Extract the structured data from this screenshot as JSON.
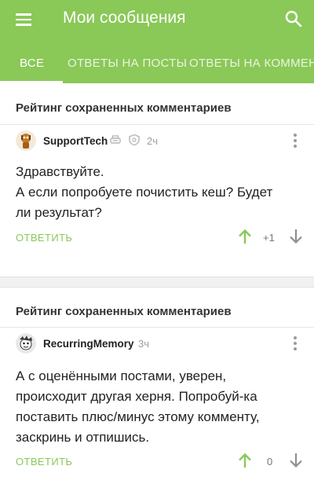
{
  "header": {
    "title": "Мои сообщения",
    "accent_color": "#8ac858",
    "menu_icon": "menu-icon",
    "search_icon": "search-icon"
  },
  "tabs": [
    {
      "label": "ВСЕ",
      "active": true
    },
    {
      "label": "ОТВЕТЫ НА ПОСТЫ",
      "active": false
    },
    {
      "label": "ОТВЕТЫ НА КОММЕНТАРИИ",
      "active": false
    }
  ],
  "comments": [
    {
      "section_title": "Рейтинг сохраненных комментариев",
      "username": "SupportTech",
      "time": "2ч",
      "badges": [
        "print-icon",
        "shield-icon"
      ],
      "lines": [
        "Здравствуйте.",
        "А если попробуете почистить кеш? Будет",
        "ли результат?"
      ],
      "reply_label": "ОТВЕТИТЬ",
      "rating": "+1"
    },
    {
      "section_title": "Рейтинг сохраненных комментариев",
      "username": "RecurringMemory",
      "time": "3ч",
      "badges": [],
      "lines": [
        "А с оценёнными постами, уверен,",
        "происходит другая херня. Попробуй-ка",
        "поставить плюс/минус этому комменту,",
        "заскринь и отпишись."
      ],
      "reply_label": "ОТВЕТИТЬ",
      "rating": "0"
    }
  ]
}
